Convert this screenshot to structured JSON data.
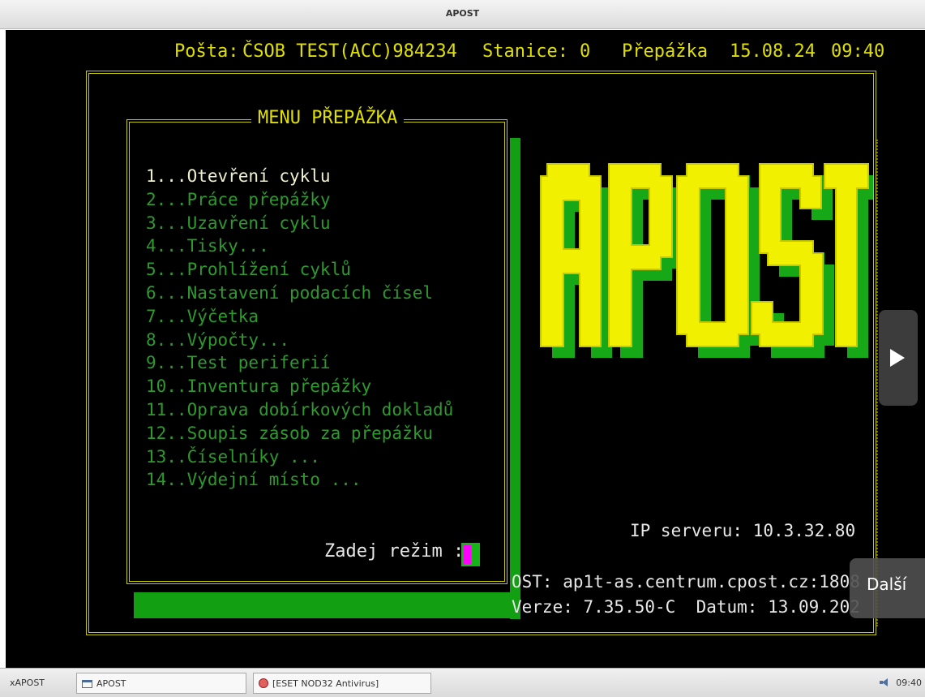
{
  "window": {
    "title": "APOST"
  },
  "header": {
    "posta_label": "Pošta:",
    "posta_value": "ČSOB TEST(ACC)984234",
    "stanice_label": "Stanice:",
    "stanice_value": "0",
    "mode": "Přepážka",
    "date": "15.08.24",
    "time": "09:40"
  },
  "menu": {
    "title": "MENU PŘEPÁŽKA",
    "items": [
      {
        "label": "1...Otevření cyklu",
        "active": true
      },
      {
        "label": "2...Práce přepážky"
      },
      {
        "label": "3...Uzavření cyklu"
      },
      {
        "label": "4...Tisky..."
      },
      {
        "label": "5...Prohlížení cyklů"
      },
      {
        "label": "6...Nastavení podacích čísel"
      },
      {
        "label": "7...Výčetka"
      },
      {
        "label": "8...Výpočty..."
      },
      {
        "label": "9...Test periferií"
      },
      {
        "label": "10..Inventura přepážky"
      },
      {
        "label": "11..Oprava dobírkových dokladů"
      },
      {
        "label": "12..Soupis zásob za přepážku"
      },
      {
        "label": "13..Číselníky ..."
      },
      {
        "label": "14..Výdejní místo ..."
      }
    ],
    "prompt": "Zadej režim :",
    "input_value": ""
  },
  "logo": {
    "text": "APOST"
  },
  "server": {
    "ip_line": "IP serveru: 10.3.32.80",
    "host_line": "OST: ap1t-as.centrum.cpost.cz:1808",
    "version_line": "Verze: 7.35.50-C  Datum: 13.09.202"
  },
  "overlay": {
    "next_label": "Další",
    "arrow_icon": "play-arrow-icon"
  },
  "taskbar": {
    "items": [
      {
        "label": "xAPOST",
        "icon": ""
      },
      {
        "label": "APOST",
        "icon": "window-icon"
      },
      {
        "label": "[ESET NOD32 Antivirus]",
        "icon": "eset-icon"
      }
    ],
    "clock": "09:40",
    "tray_icon": "speaker-icon"
  },
  "colors": {
    "terminal_bg": "#000000",
    "yellow": "#e0e000",
    "green": "#12a012",
    "menu_text": "#2e9a2e",
    "white_text": "#e8e8e8",
    "cursor": "#ff00ff"
  }
}
